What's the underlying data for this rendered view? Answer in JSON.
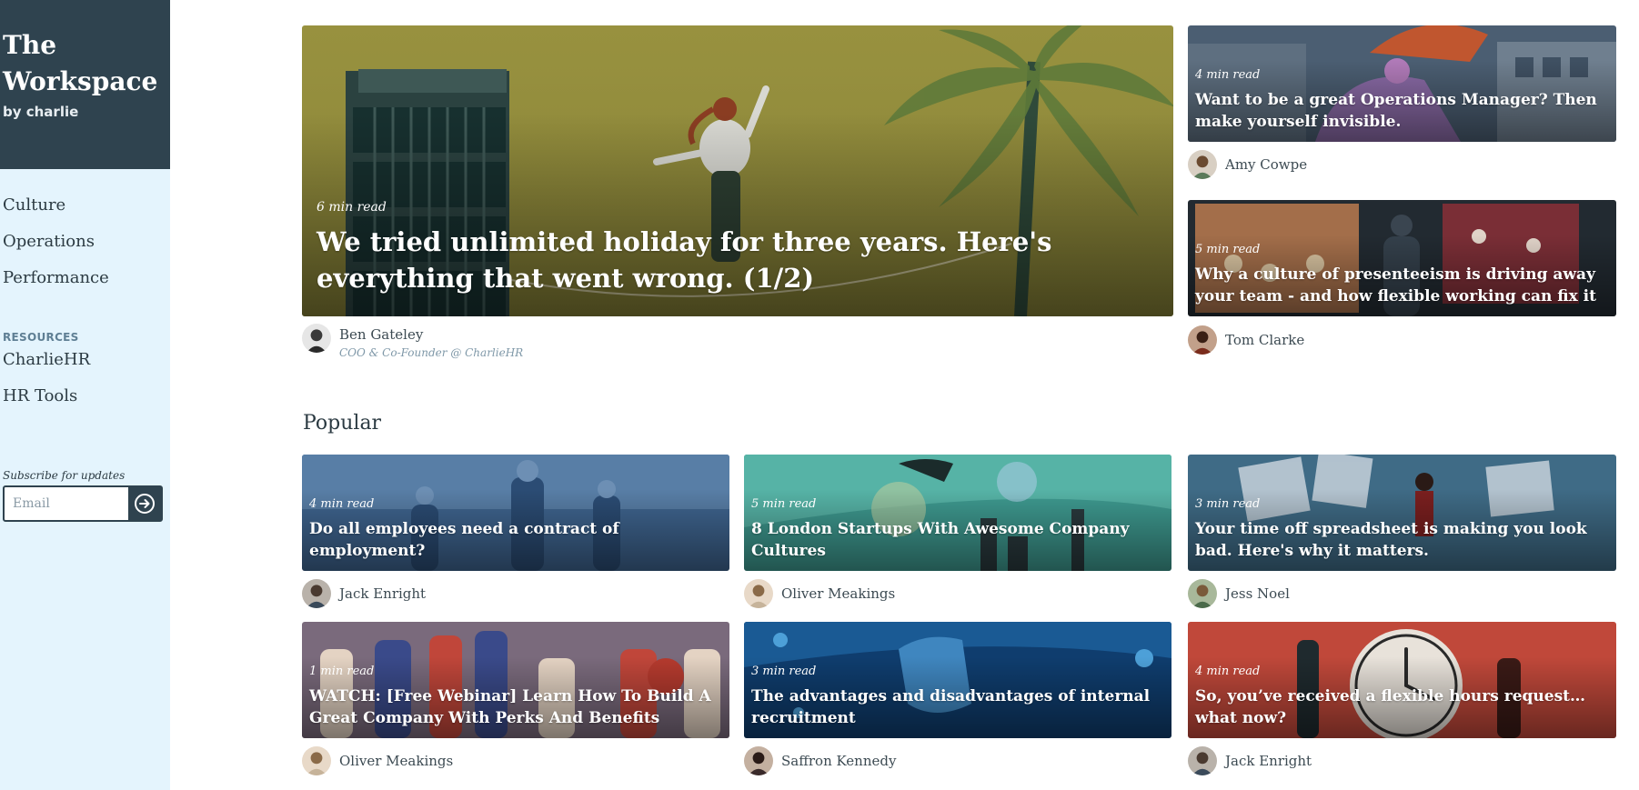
{
  "brand": {
    "title_line1": "The",
    "title_line2": "Workspace",
    "byline": "by charlie"
  },
  "nav": {
    "items": [
      "Culture",
      "Operations",
      "Performance"
    ]
  },
  "resources": {
    "label": "RESOURCES",
    "items": [
      "CharlieHR",
      "HR Tools"
    ]
  },
  "subscribe": {
    "label": "Subscribe for updates",
    "placeholder": "Email"
  },
  "featured": {
    "hero": {
      "read_time": "6 min read",
      "title": "We tried unlimited holiday for three years. Here's everything that went wrong. (1/2)",
      "author": "Ben Gateley",
      "author_role": "COO & Co-Founder @ CharlieHR"
    },
    "side": [
      {
        "read_time": "4 min read",
        "title": "Want to be a great Operations Manager? Then make yourself invisible.",
        "author": "Amy Cowpe"
      },
      {
        "read_time": "5 min read",
        "title": "Why a culture of presenteeism is driving away your team - and how flexible working can fix it",
        "author": "Tom Clarke"
      }
    ]
  },
  "popular": {
    "heading": "Popular",
    "articles": [
      {
        "read_time": "4 min read",
        "title": "Do all employees need a contract of employment?",
        "author": "Jack Enright"
      },
      {
        "read_time": "5 min read",
        "title": "8 London Startups With Awesome Company Cultures",
        "author": "Oliver Meakings"
      },
      {
        "read_time": "3 min read",
        "title": "Your time off spreadsheet is making you look bad. Here's why it matters.",
        "author": "Jess Noel"
      },
      {
        "read_time": "1 min read",
        "title": "WATCH: [Free Webinar] Learn How To Build A Great Company With Perks And Benefits",
        "author": "Oliver Meakings"
      },
      {
        "read_time": "3 min read",
        "title": "The advantages and disadvantages of internal recruitment",
        "author": "Saffron Kennedy"
      },
      {
        "read_time": "4 min read",
        "title": "So, you’ve received a flexible hours request… what now?",
        "author": "Jack Enright"
      }
    ]
  },
  "colors": {
    "sidebar_bg": "#e4f4fd",
    "brand_bg": "#2f434f",
    "text": "#2b3a42",
    "accent_muted": "#7f98a8"
  },
  "icons": {
    "subscribe": "arrow-right-circle-icon"
  }
}
